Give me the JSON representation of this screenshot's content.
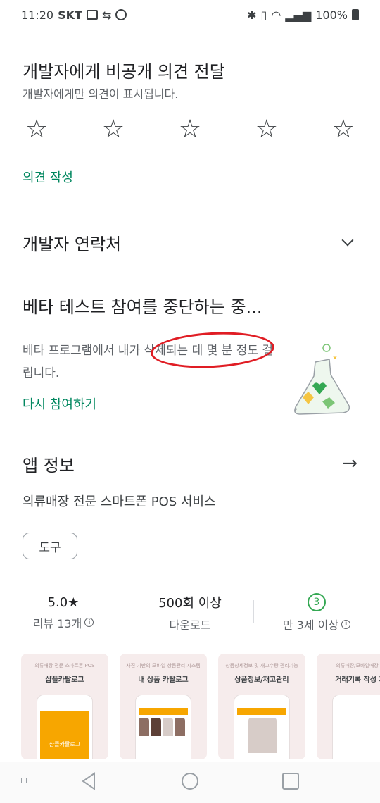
{
  "status_bar": {
    "time": "11:20",
    "carrier": "SKT",
    "battery": "100%"
  },
  "feedback": {
    "title": "개발자에게 비공개 의견 전달",
    "subtitle": "개발자에게만 의견이 표시됩니다.",
    "star_glyph": "☆",
    "write_link": "의견 작성"
  },
  "developer_contact": {
    "label": "개발자 연락처"
  },
  "beta": {
    "title": "베타 테스트 참여를 중단하는 중...",
    "description": "베타 프로그램에서 내가 삭제되는 데 몇 분 정도 걸립니다.",
    "rejoin_link": "다시 참여하기"
  },
  "app_info": {
    "label": "앱 정보",
    "arrow": "→",
    "description": "의류매장 전문 스마트폰 POS 서비스",
    "tag": "도구"
  },
  "stats": {
    "rating_value": "5.0★",
    "rating_label": "리뷰 13개",
    "downloads_value": "500회 이상",
    "downloads_label": "다운로드",
    "age_badge": "3",
    "age_label": "만 3세 이상"
  },
  "screenshots": [
    {
      "caption": "의류매장 전문 스마트폰 POS",
      "title": "샵플카탈로그",
      "phone_text": "샵플카탈로그"
    },
    {
      "caption": "사진 기반의 모바일 상품관리 시스템",
      "title": "내 상품 카탈로그"
    },
    {
      "caption": "상품상세정보 및 재고수량 관리기능",
      "title": "상품정보/재고관리"
    },
    {
      "caption": "의류매장/모바일매장 판",
      "title": "거래기록 작성 기"
    }
  ],
  "colors": {
    "accent": "#01875f",
    "highlight": "#e01d24",
    "screenshot_orange": "#f7a600"
  }
}
